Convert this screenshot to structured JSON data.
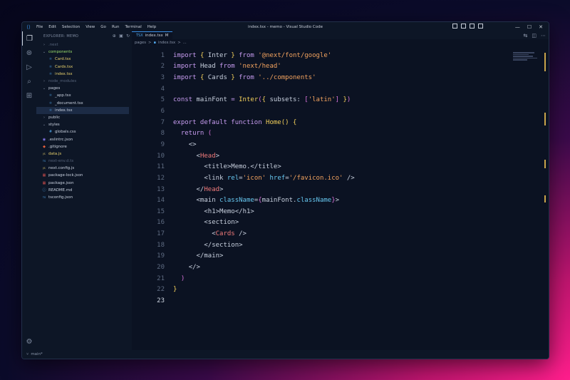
{
  "titlebar": {
    "menu": [
      "File",
      "Edit",
      "Selection",
      "View",
      "Go",
      "Run",
      "Terminal",
      "Help"
    ],
    "title": "index.tsx - memo - Visual Studio Code"
  },
  "explorer": {
    "header": "EXPLORER: MEMO",
    "items": [
      {
        "label": ".next",
        "indent": 0,
        "color": "dim",
        "icon": "chevron-right-icon",
        "status": ""
      },
      {
        "label": "components",
        "indent": 0,
        "color": "green",
        "icon": "chevron-down-icon",
        "status": "•"
      },
      {
        "label": "Card.tsx",
        "indent": 1,
        "color": "yellow",
        "icon": "tsx-icon",
        "status": "U"
      },
      {
        "label": "Cards.tsx",
        "indent": 1,
        "color": "yellow",
        "icon": "tsx-icon",
        "status": "U"
      },
      {
        "label": "index.tsx",
        "indent": 1,
        "color": "yellow",
        "icon": "tsx-icon",
        "status": "U"
      },
      {
        "label": "node_modules",
        "indent": 0,
        "color": "dim",
        "icon": "chevron-right-icon",
        "status": ""
      },
      {
        "label": "pages",
        "indent": 0,
        "color": "white",
        "icon": "chevron-down-icon",
        "status": ""
      },
      {
        "label": "_app.tsx",
        "indent": 1,
        "color": "white",
        "icon": "tsx-icon",
        "status": "M"
      },
      {
        "label": "_document.tsx",
        "indent": 1,
        "color": "white",
        "icon": "tsx-icon",
        "status": "M"
      },
      {
        "label": "index.tsx",
        "indent": 1,
        "color": "white",
        "icon": "tsx-icon",
        "status": "M",
        "selected": true
      },
      {
        "label": "public",
        "indent": 0,
        "color": "white",
        "icon": "chevron-right-icon",
        "status": ""
      },
      {
        "label": "styles",
        "indent": 0,
        "color": "white",
        "icon": "chevron-down-icon",
        "status": "•"
      },
      {
        "label": "globals.css",
        "indent": 1,
        "color": "white",
        "icon": "css-icon",
        "status": "M"
      },
      {
        "label": ".eslintrc.json",
        "indent": 0,
        "color": "white",
        "icon": "eslint-icon",
        "status": ""
      },
      {
        "label": ".gitignore",
        "indent": 0,
        "color": "white",
        "icon": "git-icon",
        "status": ""
      },
      {
        "label": "data.js",
        "indent": 0,
        "color": "yellow",
        "icon": "js-icon",
        "status": "U"
      },
      {
        "label": "next-env.d.ts",
        "indent": 0,
        "color": "dim",
        "icon": "ts-icon",
        "status": ""
      },
      {
        "label": "next.config.js",
        "indent": 0,
        "color": "white",
        "icon": "js-icon",
        "status": ""
      },
      {
        "label": "package-lock.json",
        "indent": 0,
        "color": "white",
        "icon": "npm-icon",
        "status": ""
      },
      {
        "label": "package.json",
        "indent": 0,
        "color": "white",
        "icon": "npm-icon",
        "status": ""
      },
      {
        "label": "README.md",
        "indent": 0,
        "color": "white",
        "icon": "info-icon",
        "status": ""
      },
      {
        "label": "tsconfig.json",
        "indent": 0,
        "color": "white",
        "icon": "ts-icon",
        "status": ""
      }
    ]
  },
  "tab": {
    "label": "index.tsx",
    "ext": "TSX",
    "modified": "M"
  },
  "breadcrumb": {
    "folder": "pages",
    "sep": ">",
    "file": "index.tsx",
    "rest": "..."
  },
  "code": {
    "current_line": 23,
    "lines": [
      [
        [
          "kw",
          "import "
        ],
        [
          "k",
          "{ "
        ],
        [
          "txt",
          "Inter "
        ],
        [
          "k",
          "} "
        ],
        [
          "kw",
          "from "
        ],
        [
          "str",
          "'@next/font/google'"
        ]
      ],
      [
        [
          "kw",
          "import "
        ],
        [
          "txt",
          "Head "
        ],
        [
          "kw",
          "from "
        ],
        [
          "str",
          "'next/head'"
        ]
      ],
      [
        [
          "kw",
          "import "
        ],
        [
          "k",
          "{ "
        ],
        [
          "txt",
          "Cards "
        ],
        [
          "k",
          "} "
        ],
        [
          "kw",
          "from "
        ],
        [
          "str",
          "'../components'"
        ]
      ],
      [],
      [
        [
          "kw",
          "const "
        ],
        [
          "txt",
          "mainFont "
        ],
        [
          "kw",
          "= "
        ],
        [
          "fn",
          "Inter"
        ],
        [
          "br2",
          "("
        ],
        [
          "k",
          "{ "
        ],
        [
          "txt",
          "subsets: "
        ],
        [
          "br2",
          "["
        ],
        [
          "str",
          "'latin'"
        ],
        [
          "br2",
          "]"
        ],
        [
          "k",
          " }"
        ],
        [
          "br2",
          ")"
        ]
      ],
      [],
      [
        [
          "kw",
          "export default function "
        ],
        [
          "fn",
          "Home"
        ],
        [
          "br",
          "() "
        ],
        [
          "k",
          "{"
        ]
      ],
      [
        [
          "txt",
          "  "
        ],
        [
          "kw",
          "return "
        ],
        [
          "br2",
          "("
        ]
      ],
      [
        [
          "txt",
          "    "
        ],
        [
          "tag",
          "<>"
        ]
      ],
      [
        [
          "txt",
          "      "
        ],
        [
          "tag",
          "<"
        ],
        [
          "cmp",
          "Head"
        ],
        [
          "tag",
          ">"
        ]
      ],
      [
        [
          "txt",
          "        "
        ],
        [
          "tag",
          "<title>"
        ],
        [
          "txt",
          "Memo."
        ],
        [
          "tag",
          "</title>"
        ]
      ],
      [
        [
          "txt",
          "        "
        ],
        [
          "tag",
          "<link "
        ],
        [
          "attr",
          "rel"
        ],
        [
          "txt",
          "="
        ],
        [
          "str",
          "'icon' "
        ],
        [
          "attr",
          "href"
        ],
        [
          "txt",
          "="
        ],
        [
          "str",
          "'/favicon.ico' "
        ],
        [
          "tag",
          "/>"
        ]
      ],
      [
        [
          "txt",
          "      "
        ],
        [
          "tag",
          "</"
        ],
        [
          "cmp",
          "Head"
        ],
        [
          "tag",
          ">"
        ]
      ],
      [
        [
          "txt",
          "      "
        ],
        [
          "tag",
          "<main "
        ],
        [
          "attr",
          "className"
        ],
        [
          "txt",
          "="
        ],
        [
          "br2",
          "{"
        ],
        [
          "txt",
          "mainFont."
        ],
        [
          "attr",
          "className"
        ],
        [
          "br2",
          "}"
        ],
        [
          "tag",
          ">"
        ]
      ],
      [
        [
          "txt",
          "        "
        ],
        [
          "tag",
          "<h1>"
        ],
        [
          "txt",
          "Memo"
        ],
        [
          "tag",
          "</h1>"
        ]
      ],
      [
        [
          "txt",
          "        "
        ],
        [
          "tag",
          "<section>"
        ]
      ],
      [
        [
          "txt",
          "          "
        ],
        [
          "tag",
          "<"
        ],
        [
          "cmp",
          "Cards "
        ],
        [
          "tag",
          "/>"
        ]
      ],
      [
        [
          "txt",
          "        "
        ],
        [
          "tag",
          "</section>"
        ]
      ],
      [
        [
          "txt",
          "      "
        ],
        [
          "tag",
          "</main>"
        ]
      ],
      [
        [
          "txt",
          "    "
        ],
        [
          "tag",
          "</>"
        ]
      ],
      [
        [
          "txt",
          "  "
        ],
        [
          "br2",
          ")"
        ]
      ],
      [
        [
          "k",
          "}"
        ]
      ],
      []
    ]
  },
  "statusbar": {
    "branch": "main*"
  },
  "colors": {
    "accent": "#3a8fe6",
    "editor_bg": "#0b1222",
    "sidebar_bg": "#0d1626"
  }
}
